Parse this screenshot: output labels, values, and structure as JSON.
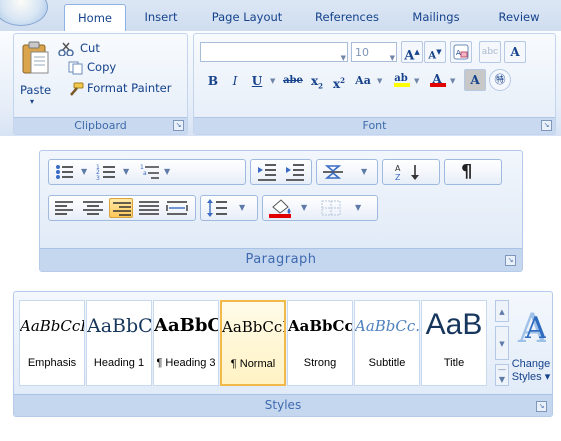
{
  "ribbon": {
    "tabs": [
      {
        "label": "Home",
        "active": true
      },
      {
        "label": "Insert"
      },
      {
        "label": "Page Layout"
      },
      {
        "label": "References"
      },
      {
        "label": "Mailings"
      },
      {
        "label": "Review"
      }
    ],
    "clipboard": {
      "paste_label": "Paste",
      "cut_label": "Cut",
      "copy_label": "Copy",
      "format_painter_label": "Format Painter",
      "group_label": "Clipboard"
    },
    "font": {
      "font_name_value": "",
      "font_size_value": "10",
      "grow_label": "A",
      "shrink_label": "A",
      "bold_label": "B",
      "italic_label": "I",
      "underline_label": "U",
      "strikethrough_label": "abe",
      "subscript_label": "x",
      "superscript_label": "x",
      "change_case_label": "Aa",
      "highlight_label": "ab",
      "font_color_label": "A",
      "char_shading_label": "A",
      "group_label": "Font"
    }
  },
  "paragraph": {
    "group_label": "Paragraph"
  },
  "styles": {
    "items": [
      {
        "sample": "AaBbCcI",
        "name": "Emphasis"
      },
      {
        "sample": "AaBbC",
        "name": "Heading 1"
      },
      {
        "sample": "AaBbC",
        "name": "¶ Heading 3"
      },
      {
        "sample": "AaBbCcI",
        "name": "¶ Normal",
        "selected": true
      },
      {
        "sample": "AaBbCcl",
        "name": "Strong"
      },
      {
        "sample": "AaBbCc.",
        "name": "Subtitle"
      },
      {
        "sample": "AaB",
        "name": "Title"
      }
    ],
    "change_styles_label_1": "Change",
    "change_styles_label_2": "Styles ▾",
    "group_label": "Styles"
  },
  "colors": {
    "ribbon_text": "#15428b",
    "group_label_text": "#3e6aaa",
    "highlight_yellow": "#ffff00",
    "font_color_red": "#e00000",
    "selected_border": "#f0b94a"
  }
}
